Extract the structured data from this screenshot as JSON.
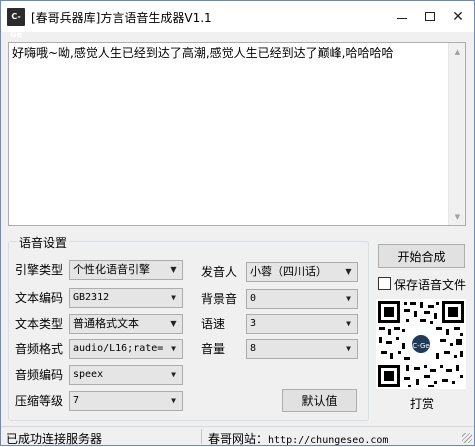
{
  "window": {
    "app_icon_text": "C-Ge",
    "title": "[春哥兵器库]方言语音生成器V1.1"
  },
  "editor": {
    "text": "好嗨哦~呦,感觉人生已经到达了高潮,感觉人生已经到达了巅峰,哈哈哈哈"
  },
  "settings": {
    "group_title": "语音设置",
    "engine_type": {
      "label": "引擎类型",
      "value": "个性化语音引擎"
    },
    "text_encoding": {
      "label": "文本编码",
      "value": "GB2312"
    },
    "text_type": {
      "label": "文本类型",
      "value": "普通格式文本"
    },
    "audio_format": {
      "label": "音频格式",
      "value": "audio/L16;rate="
    },
    "audio_codec": {
      "label": "音频编码",
      "value": "speex"
    },
    "compression": {
      "label": "压缩等级",
      "value": "7"
    },
    "speaker": {
      "label": "发音人",
      "value": "小蓉（四川话）"
    },
    "bg_sound": {
      "label": "背景音",
      "value": "0"
    },
    "speed": {
      "label": "语速",
      "value": "3"
    },
    "volume": {
      "label": "音量",
      "value": "8"
    },
    "default_button": "默认值"
  },
  "side": {
    "start_button": "开始合成",
    "save_checkbox_label": "保存语音文件",
    "save_checked": false,
    "qr_logo_text": "C-Ge",
    "reward_label": "打赏"
  },
  "status": {
    "left": "已成功连接服务器",
    "right_label": "春哥网站：",
    "right_url": "http://chungeseo.com"
  },
  "icons": {
    "minimize": "minimize-icon",
    "maximize": "maximize-icon",
    "close": "close-icon",
    "dropdown": "chevron-down-icon"
  }
}
